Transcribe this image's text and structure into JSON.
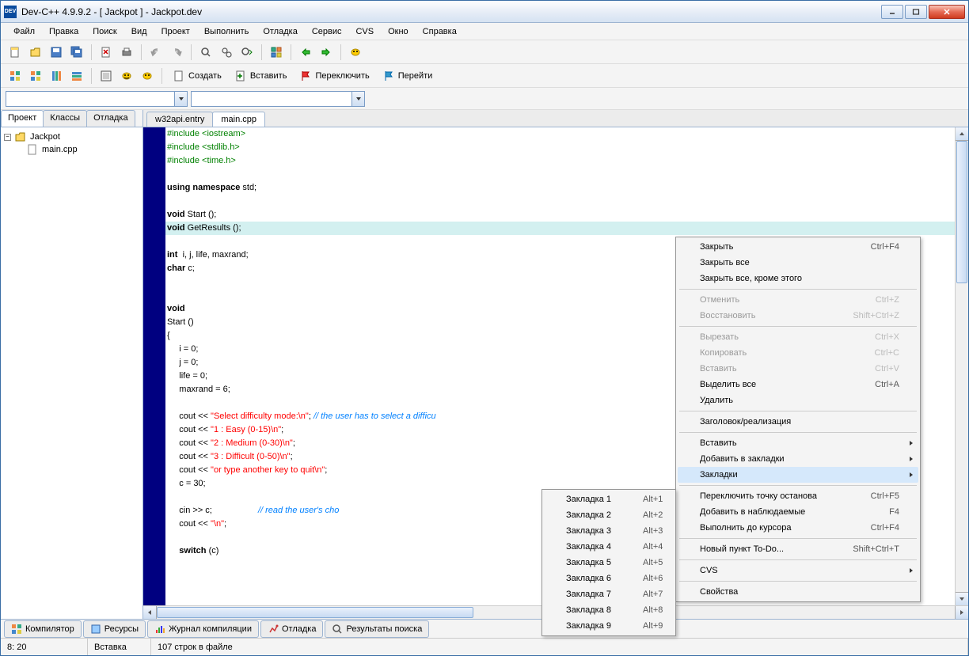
{
  "title": "Dev-C++ 4.9.9.2  -  [ Jackpot ] - Jackpot.dev",
  "menubar": [
    "Файл",
    "Правка",
    "Поиск",
    "Вид",
    "Проект",
    "Выполнить",
    "Отладка",
    "Сервис",
    "CVS",
    "Окно",
    "Справка"
  ],
  "toolbar_labeled": [
    "Создать",
    "Вставить",
    "Переключить",
    "Перейти"
  ],
  "side_tabs": [
    "Проект",
    "Классы",
    "Отладка"
  ],
  "tree": {
    "root": "Jackpot",
    "child": "main.cpp"
  },
  "file_tabs": [
    "w32api.entry",
    "main.cpp"
  ],
  "code_lines": [
    {
      "segs": [
        {
          "c": "kw-pre",
          "t": "#include <iostream>"
        }
      ]
    },
    {
      "segs": [
        {
          "c": "kw-pre",
          "t": "#include <stdlib.h>"
        }
      ]
    },
    {
      "segs": [
        {
          "c": "kw-pre",
          "t": "#include <time.h>"
        }
      ]
    },
    {
      "segs": [
        {
          "c": "",
          "t": ""
        }
      ]
    },
    {
      "segs": [
        {
          "c": "kw-blue",
          "t": "using namespace"
        },
        {
          "c": "kw-black",
          "t": " std;"
        }
      ]
    },
    {
      "segs": [
        {
          "c": "",
          "t": ""
        }
      ]
    },
    {
      "segs": [
        {
          "c": "kw-blue",
          "t": "void"
        },
        {
          "c": "kw-black",
          "t": " Start ();"
        }
      ]
    },
    {
      "segs": [
        {
          "c": "kw-blue",
          "t": "void"
        },
        {
          "c": "kw-black",
          "t": " GetResults ();"
        }
      ],
      "hl": true
    },
    {
      "segs": [
        {
          "c": "",
          "t": ""
        }
      ]
    },
    {
      "segs": [
        {
          "c": "kw-blue",
          "t": "int"
        },
        {
          "c": "kw-black",
          "t": "  i, j, life, maxrand;"
        }
      ]
    },
    {
      "segs": [
        {
          "c": "kw-blue",
          "t": "char"
        },
        {
          "c": "kw-black",
          "t": " c;"
        }
      ]
    },
    {
      "segs": [
        {
          "c": "",
          "t": ""
        }
      ]
    },
    {
      "segs": [
        {
          "c": "",
          "t": ""
        }
      ]
    },
    {
      "segs": [
        {
          "c": "kw-blue",
          "t": "void"
        }
      ]
    },
    {
      "segs": [
        {
          "c": "kw-black",
          "t": "Start ()"
        }
      ]
    },
    {
      "segs": [
        {
          "c": "kw-black",
          "t": "{"
        }
      ]
    },
    {
      "segs": [
        {
          "c": "kw-black",
          "t": "     i = 0;"
        }
      ]
    },
    {
      "segs": [
        {
          "c": "kw-black",
          "t": "     j = 0;"
        }
      ]
    },
    {
      "segs": [
        {
          "c": "kw-black",
          "t": "     life = 0;"
        }
      ]
    },
    {
      "segs": [
        {
          "c": "kw-black",
          "t": "     maxrand = 6;"
        }
      ]
    },
    {
      "segs": [
        {
          "c": "",
          "t": ""
        }
      ]
    },
    {
      "segs": [
        {
          "c": "kw-black",
          "t": "     cout << "
        },
        {
          "c": "kw-str",
          "t": "\"Select difficulty mode:\\n\""
        },
        {
          "c": "kw-black",
          "t": "; "
        },
        {
          "c": "kw-cmt",
          "t": "// the user has to select a difficu"
        }
      ]
    },
    {
      "segs": [
        {
          "c": "kw-black",
          "t": "     cout << "
        },
        {
          "c": "kw-str",
          "t": "\"1 : Easy (0-15)\\n\""
        },
        {
          "c": "kw-black",
          "t": ";"
        }
      ]
    },
    {
      "segs": [
        {
          "c": "kw-black",
          "t": "     cout << "
        },
        {
          "c": "kw-str",
          "t": "\"2 : Medium (0-30)\\n\""
        },
        {
          "c": "kw-black",
          "t": ";"
        }
      ]
    },
    {
      "segs": [
        {
          "c": "kw-black",
          "t": "     cout << "
        },
        {
          "c": "kw-str",
          "t": "\"3 : Difficult (0-50)\\n\""
        },
        {
          "c": "kw-black",
          "t": ";"
        }
      ]
    },
    {
      "segs": [
        {
          "c": "kw-black",
          "t": "     cout << "
        },
        {
          "c": "kw-str",
          "t": "\"or type another key to quit\\n\""
        },
        {
          "c": "kw-black",
          "t": ";"
        }
      ]
    },
    {
      "segs": [
        {
          "c": "kw-black",
          "t": "     c = 30;"
        }
      ]
    },
    {
      "segs": [
        {
          "c": "",
          "t": ""
        }
      ]
    },
    {
      "segs": [
        {
          "c": "kw-black",
          "t": "     cin >> c;                   "
        },
        {
          "c": "kw-cmt",
          "t": "// read the user's cho"
        }
      ]
    },
    {
      "segs": [
        {
          "c": "kw-black",
          "t": "     cout << "
        },
        {
          "c": "kw-str",
          "t": "\"\\n\""
        },
        {
          "c": "kw-black",
          "t": ";"
        }
      ]
    },
    {
      "segs": [
        {
          "c": "",
          "t": ""
        }
      ]
    },
    {
      "segs": [
        {
          "c": "kw-black",
          "t": "     "
        },
        {
          "c": "kw-blue",
          "t": "switch"
        },
        {
          "c": "kw-black",
          "t": " (c)"
        }
      ]
    }
  ],
  "bottom_tabs": [
    "Компилятор",
    "Ресурсы",
    "Журнал компиляции",
    "Отладка",
    "Результаты поиска"
  ],
  "status": {
    "pos": "8: 20",
    "mode": "Вставка",
    "lines": "107 строк в файле"
  },
  "context_main": [
    {
      "label": "Закрыть",
      "shortcut": "Ctrl+F4"
    },
    {
      "label": "Закрыть все"
    },
    {
      "label": "Закрыть все, кроме этого"
    },
    {
      "type": "sep"
    },
    {
      "label": "Отменить",
      "shortcut": "Ctrl+Z",
      "disabled": true
    },
    {
      "label": "Восстановить",
      "shortcut": "Shift+Ctrl+Z",
      "disabled": true
    },
    {
      "type": "sep"
    },
    {
      "label": "Вырезать",
      "shortcut": "Ctrl+X",
      "disabled": true
    },
    {
      "label": "Копировать",
      "shortcut": "Ctrl+C",
      "disabled": true
    },
    {
      "label": "Вставить",
      "shortcut": "Ctrl+V",
      "disabled": true
    },
    {
      "label": "Выделить все",
      "shortcut": "Ctrl+A"
    },
    {
      "label": "Удалить"
    },
    {
      "type": "sep"
    },
    {
      "label": "Заголовок/реализация"
    },
    {
      "type": "sep"
    },
    {
      "label": "Вставить",
      "submenu": true
    },
    {
      "label": "Добавить в закладки",
      "submenu": true
    },
    {
      "label": "Закладки",
      "submenu": true,
      "highlighted": true
    },
    {
      "type": "sep"
    },
    {
      "label": "Переключить точку останова",
      "shortcut": "Ctrl+F5"
    },
    {
      "label": "Добавить в наблюдаемые",
      "shortcut": "F4"
    },
    {
      "label": "Выполнить до курсора",
      "shortcut": "Ctrl+F4"
    },
    {
      "type": "sep"
    },
    {
      "label": "Новый пункт To-Do...",
      "shortcut": "Shift+Ctrl+T"
    },
    {
      "type": "sep"
    },
    {
      "label": "CVS",
      "submenu": true
    },
    {
      "type": "sep"
    },
    {
      "label": "Свойства"
    }
  ],
  "context_sub": [
    {
      "label": "Закладка 1",
      "shortcut": "Alt+1"
    },
    {
      "label": "Закладка 2",
      "shortcut": "Alt+2"
    },
    {
      "label": "Закладка 3",
      "shortcut": "Alt+3"
    },
    {
      "label": "Закладка 4",
      "shortcut": "Alt+4"
    },
    {
      "label": "Закладка 5",
      "shortcut": "Alt+5"
    },
    {
      "label": "Закладка 6",
      "shortcut": "Alt+6"
    },
    {
      "label": "Закладка 7",
      "shortcut": "Alt+7"
    },
    {
      "label": "Закладка 8",
      "shortcut": "Alt+8"
    },
    {
      "label": "Закладка 9",
      "shortcut": "Alt+9"
    }
  ]
}
